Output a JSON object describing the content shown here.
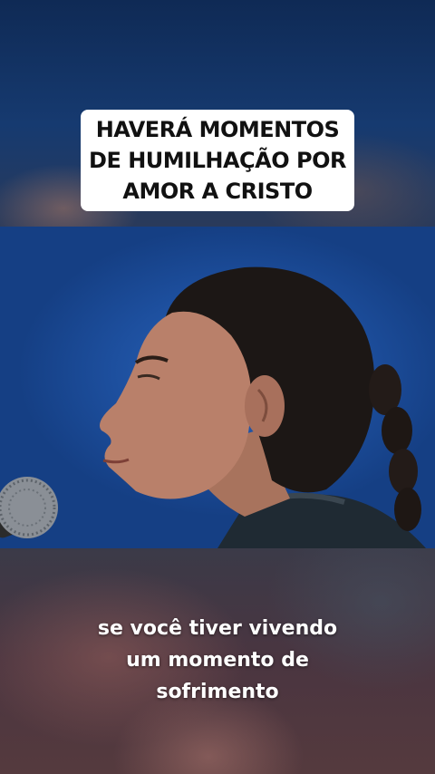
{
  "caption": {
    "title_lines": [
      "HAVERÁ MOMENTOS",
      "DE HUMILHAÇÃO POR",
      "AMOR A CRISTO"
    ]
  },
  "subtitle": {
    "lines": [
      "se você tiver vivendo",
      "um momento de",
      "sofrimento"
    ]
  },
  "video": {
    "content": "woman-singer-profile-with-microphone-icon"
  },
  "colors": {
    "stage_blue": "#1d4f9e",
    "caption_bg": "#ffffff",
    "caption_text": "#111111",
    "subtitle_text": "#ffffff"
  }
}
